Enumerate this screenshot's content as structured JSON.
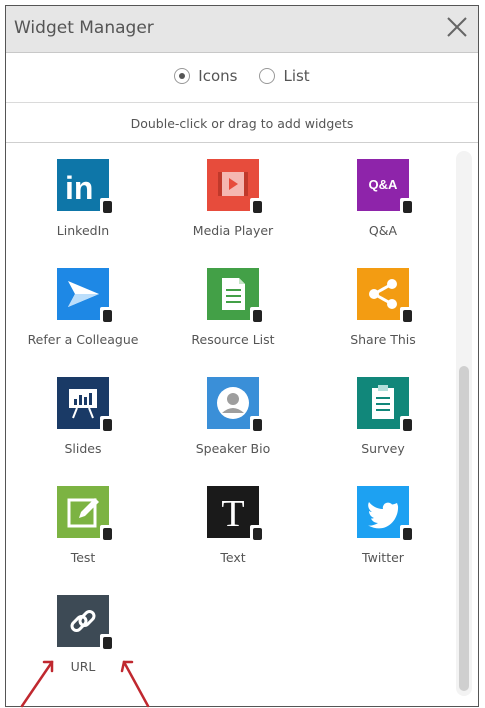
{
  "window": {
    "title": "Widget Manager"
  },
  "view": {
    "options": [
      {
        "label": "Icons",
        "selected": true
      },
      {
        "label": "List",
        "selected": false
      }
    ]
  },
  "hint": "Double-click or drag to add widgets",
  "widgets": [
    {
      "label": "LinkedIn",
      "icon": "linkedin-icon",
      "color": "#0e76a8"
    },
    {
      "label": "Media Player",
      "icon": "media-player-icon",
      "color": "#e74c3c"
    },
    {
      "label": "Q&A",
      "icon": "qa-icon",
      "color": "#8e24aa"
    },
    {
      "label": "Refer a Colleague",
      "icon": "paper-plane-icon",
      "color": "#1e88e5"
    },
    {
      "label": "Resource List",
      "icon": "document-icon",
      "color": "#43a047"
    },
    {
      "label": "Share This",
      "icon": "share-icon",
      "color": "#f39c12"
    },
    {
      "label": "Slides",
      "icon": "presentation-icon",
      "color": "#1a3a66"
    },
    {
      "label": "Speaker Bio",
      "icon": "person-icon",
      "color": "#3a8fd8"
    },
    {
      "label": "Survey",
      "icon": "clipboard-icon",
      "color": "#11877a"
    },
    {
      "label": "Test",
      "icon": "edit-icon",
      "color": "#7cb342"
    },
    {
      "label": "Text",
      "icon": "text-icon",
      "color": "#1a1a1a"
    },
    {
      "label": "Twitter",
      "icon": "twitter-icon",
      "color": "#1da1f2"
    },
    {
      "label": "URL",
      "icon": "link-icon",
      "color": "#3d4a55"
    }
  ],
  "annotation_color": "#c0282f"
}
